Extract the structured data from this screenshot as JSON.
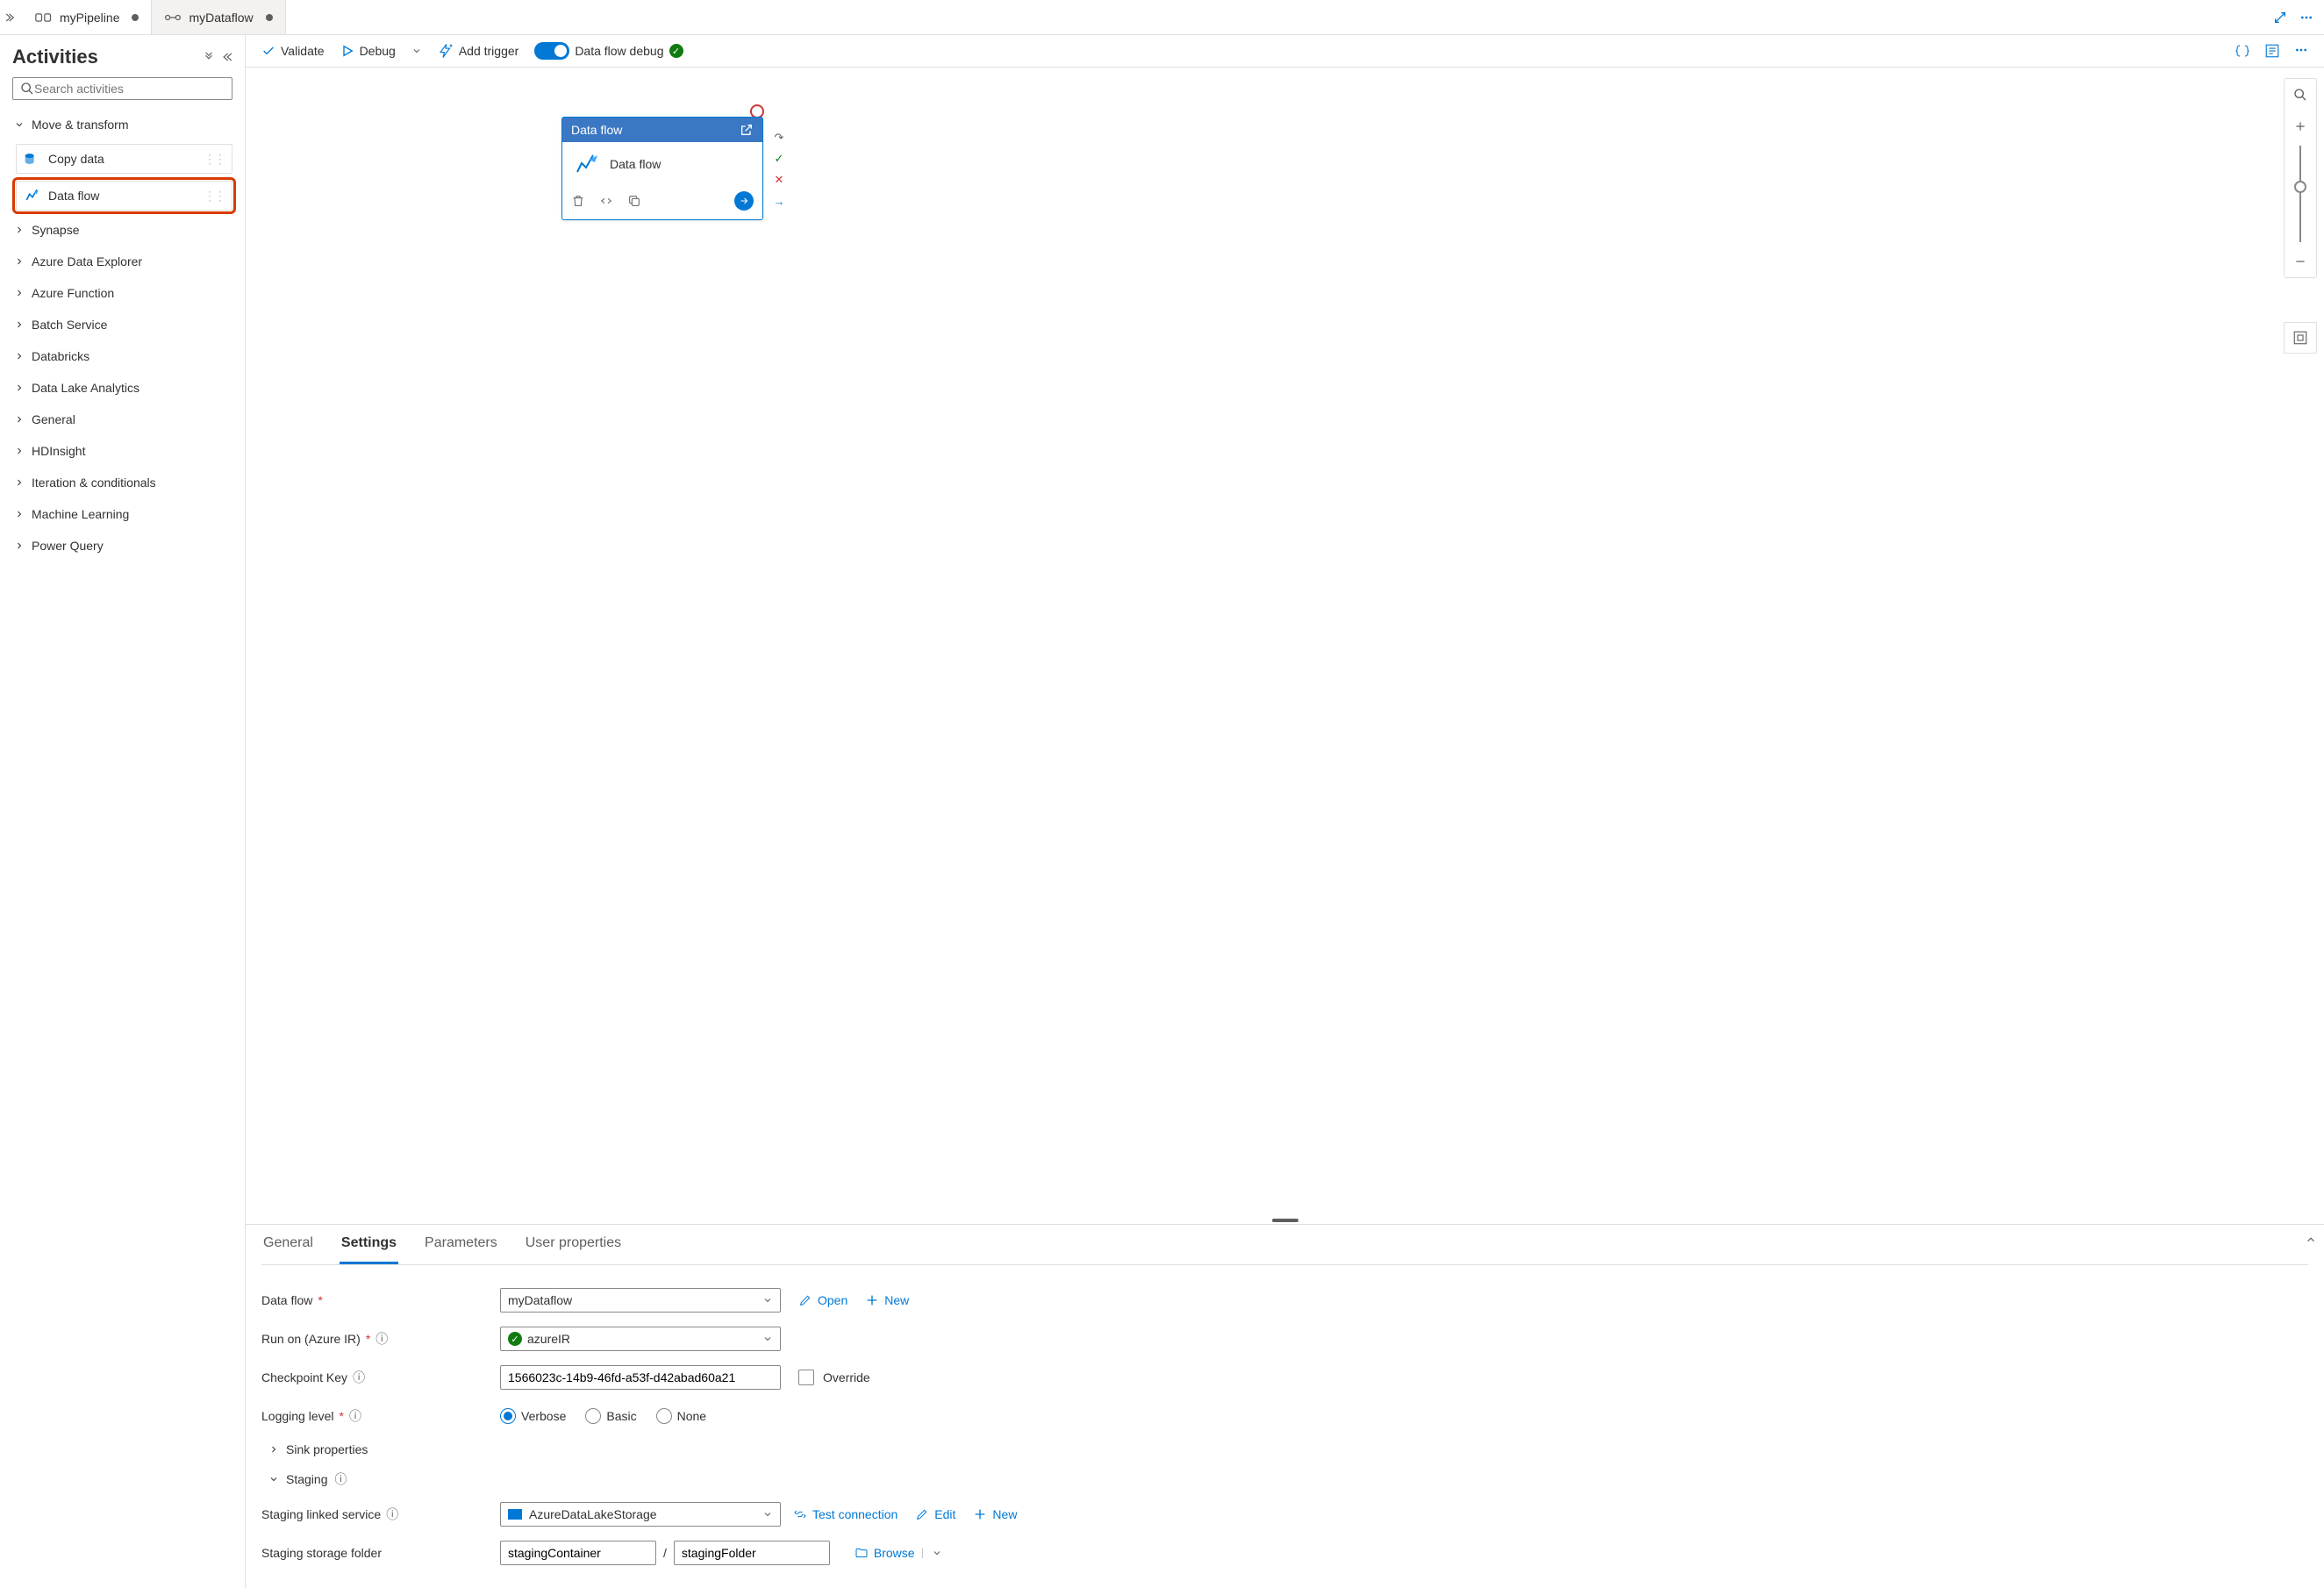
{
  "tabs": [
    {
      "label": "myPipeline",
      "dirty": true,
      "active": true
    },
    {
      "label": "myDataflow",
      "dirty": true,
      "active": false
    }
  ],
  "sidebar": {
    "title": "Activities",
    "search_placeholder": "Search activities",
    "expanded_category": "Move & transform",
    "items_expanded": [
      {
        "label": "Copy data",
        "selected": false
      },
      {
        "label": "Data flow",
        "selected": true
      }
    ],
    "categories": [
      "Synapse",
      "Azure Data Explorer",
      "Azure Function",
      "Batch Service",
      "Databricks",
      "Data Lake Analytics",
      "General",
      "HDInsight",
      "Iteration & conditionals",
      "Machine Learning",
      "Power Query"
    ]
  },
  "toolbar": {
    "validate": "Validate",
    "debug": "Debug",
    "add_trigger": "Add trigger",
    "dataflow_debug": "Data flow debug"
  },
  "node": {
    "type_label": "Data flow",
    "name": "Data flow"
  },
  "properties": {
    "tabs": [
      "General",
      "Settings",
      "Parameters",
      "User properties"
    ],
    "active_tab": "Settings",
    "labels": {
      "data_flow": "Data flow",
      "run_on": "Run on (Azure IR)",
      "checkpoint": "Checkpoint Key",
      "logging": "Logging level",
      "sink": "Sink properties",
      "staging": "Staging",
      "staging_service": "Staging linked service",
      "staging_folder": "Staging storage folder"
    },
    "values": {
      "data_flow": "myDataflow",
      "run_on": "azureIR",
      "checkpoint": "1566023c-14b9-46fd-a53f-d42abad60a21",
      "staging_service": "AzureDataLakeStorage",
      "folder_container": "stagingContainer",
      "folder_path": "stagingFolder"
    },
    "override_label": "Override",
    "logging_options": [
      "Verbose",
      "Basic",
      "None"
    ],
    "logging_selected": "Verbose",
    "actions": {
      "open": "Open",
      "new": "New",
      "test": "Test connection",
      "edit": "Edit",
      "browse": "Browse"
    }
  }
}
